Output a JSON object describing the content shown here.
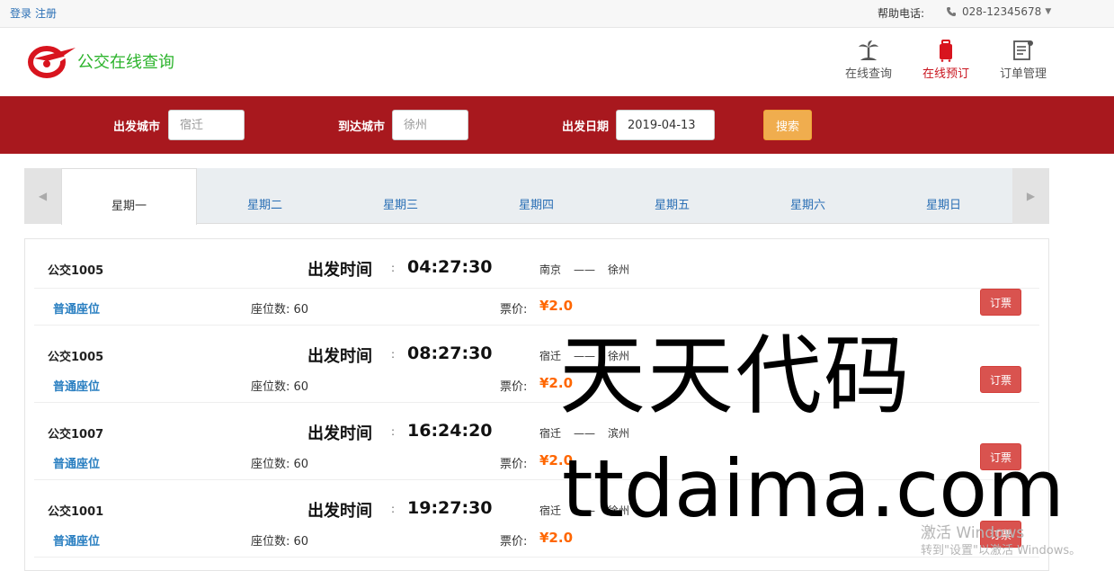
{
  "topbar": {
    "login": "登录",
    "register": "注册",
    "help_label": "帮助电话:",
    "phone": "028-12345678"
  },
  "header": {
    "brand": "公交在线查询",
    "nav": [
      {
        "label": "在线查询",
        "icon": "palm-tree-icon"
      },
      {
        "label": "在线预订",
        "icon": "luggage-icon"
      },
      {
        "label": "订单管理",
        "icon": "order-list-icon"
      }
    ],
    "active_nav": "在线预订"
  },
  "search": {
    "from_label": "出发城市",
    "from_placeholder": "宿迁",
    "to_label": "到达城市",
    "to_placeholder": "徐州",
    "date_label": "出发日期",
    "date_value": "2019-04-13",
    "search_label": "搜索"
  },
  "week": {
    "days": [
      "星期一",
      "星期二",
      "星期三",
      "星期四",
      "星期五",
      "星期六",
      "星期日"
    ],
    "active": "星期一"
  },
  "results": [
    {
      "bus": "公交1005",
      "dep_label": "出发时间",
      "time": "04:27:30",
      "from": "南京",
      "to": "徐州",
      "seat_type": "普通座位",
      "seat_count": "座位数: 60",
      "price_label": "票价:",
      "price": "¥2.0",
      "book": "订票"
    },
    {
      "bus": "公交1005",
      "dep_label": "出发时间",
      "time": "08:27:30",
      "from": "宿迁",
      "to": "徐州",
      "seat_type": "普通座位",
      "seat_count": "座位数: 60",
      "price_label": "票价:",
      "price": "¥2.0",
      "book": "订票"
    },
    {
      "bus": "公交1007",
      "dep_label": "出发时间",
      "time": "16:24:20",
      "from": "宿迁",
      "to": "滨州",
      "seat_type": "普通座位",
      "seat_count": "座位数: 60",
      "price_label": "票价:",
      "price": "¥2.0",
      "book": "订票"
    },
    {
      "bus": "公交1001",
      "dep_label": "出发时间",
      "time": "19:27:30",
      "from": "宿迁",
      "to": "徐州",
      "seat_type": "普通座位",
      "seat_count": "座位数: 60",
      "price_label": "票价:",
      "price": "¥2.0",
      "book": "订票"
    }
  ],
  "route_dash": "——",
  "colon": ":",
  "watermark": {
    "line1": "天天代码",
    "line2": "ttdaima.com"
  },
  "windows_activation": {
    "line1": "激活 Windows",
    "line2": "转到\"设置\"以激活 Windows。"
  },
  "colors": {
    "brand_green": "#2bb32b",
    "search_bar": "#a8181e",
    "search_button": "#f0ad4e",
    "book_button": "#d9534f",
    "price": "#ff6600",
    "link_blue": "#2a6fb5"
  }
}
